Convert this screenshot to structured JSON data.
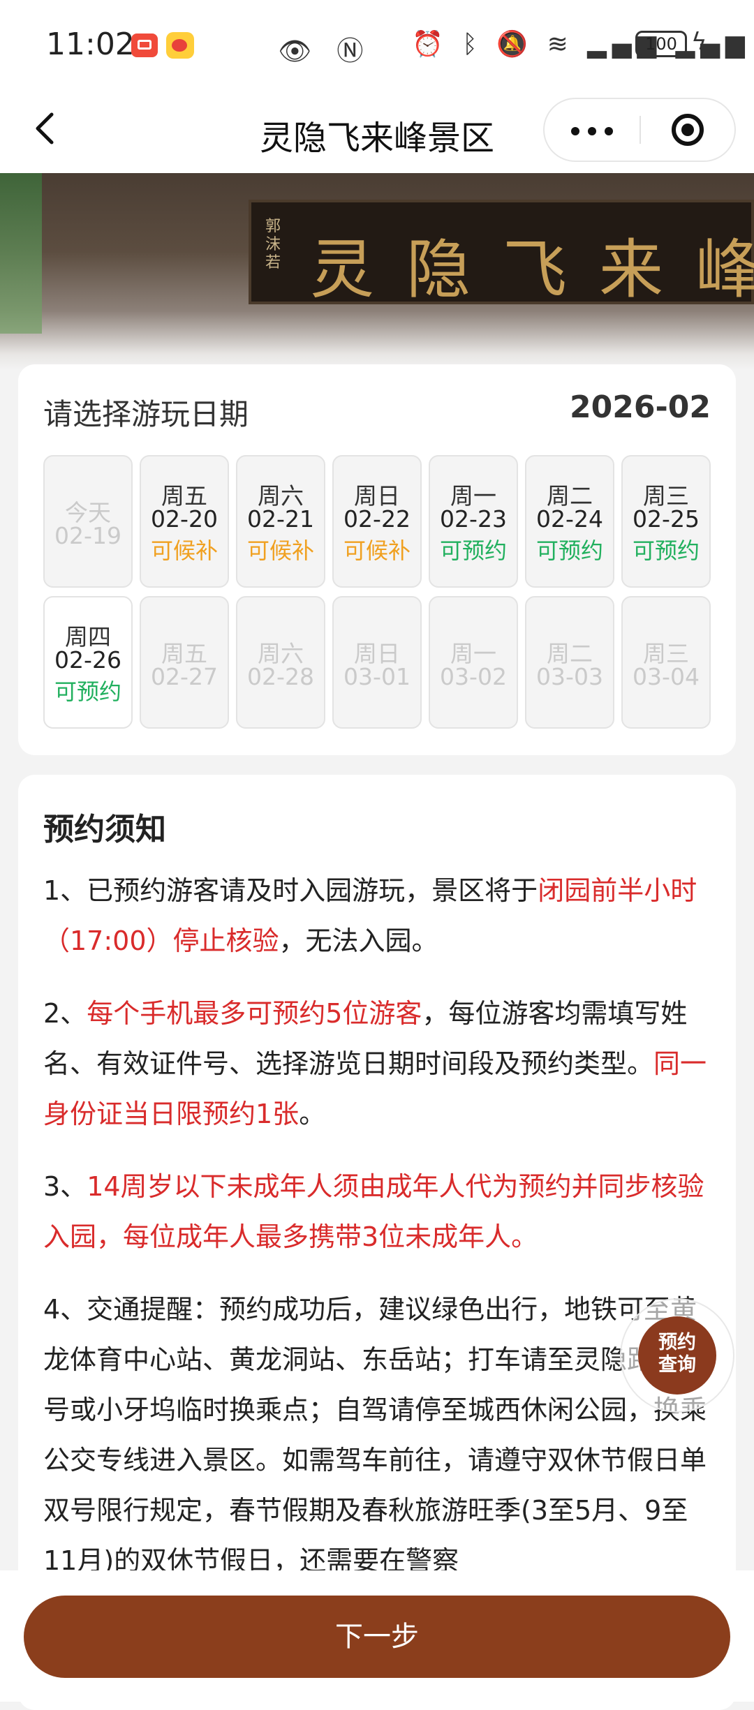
{
  "status_bar": {
    "time": "11:02",
    "battery": "100"
  },
  "nav": {
    "title": "灵隐飞来峰景区"
  },
  "banner": {
    "plaque_text": "灵隐飞来峰",
    "plaque_signature": "郭沫若"
  },
  "date_picker": {
    "title": "请选择游玩日期",
    "month": "2026-02",
    "row1": [
      {
        "weekday": "今天",
        "date": "02-19",
        "status": ""
      },
      {
        "weekday": "周五",
        "date": "02-20",
        "status": "可候补"
      },
      {
        "weekday": "周六",
        "date": "02-21",
        "status": "可候补"
      },
      {
        "weekday": "周日",
        "date": "02-22",
        "status": "可候补"
      },
      {
        "weekday": "周一",
        "date": "02-23",
        "status": "可预约"
      },
      {
        "weekday": "周二",
        "date": "02-24",
        "status": "可预约"
      },
      {
        "weekday": "周三",
        "date": "02-25",
        "status": "可预约"
      }
    ],
    "row2": [
      {
        "weekday": "周四",
        "date": "02-26",
        "status": "可预约"
      },
      {
        "weekday": "周五",
        "date": "02-27",
        "status": ""
      },
      {
        "weekday": "周六",
        "date": "02-28",
        "status": ""
      },
      {
        "weekday": "周日",
        "date": "03-01",
        "status": ""
      },
      {
        "weekday": "周一",
        "date": "03-02",
        "status": ""
      },
      {
        "weekday": "周二",
        "date": "03-03",
        "status": ""
      },
      {
        "weekday": "周三",
        "date": "03-04",
        "status": ""
      }
    ],
    "colors": {
      "waitlist": "#f0a020",
      "available": "#21b05e"
    }
  },
  "notice": {
    "title": "预约须知",
    "item1_a": "1、已预约游客请及时入园游玩，景区将于",
    "item1_red": "闭园前半小时（17:00）停止核验",
    "item1_b": "，无法入园。",
    "item2_a": "2、",
    "item2_red1": "每个手机最多可预约5位游客",
    "item2_b": "，每位游客均需填写姓名、有效证件号、选择游览日期时间段及预约类型。",
    "item2_red2": "同一身份证当日限预约1张",
    "item2_c": "。",
    "item3_a": "3、",
    "item3_red": "14周岁以下未成年人须由成年人代为预约并同步核验入园，每位成年人最多携带3位未成年人。",
    "item4": "4、交通提醒：预约成功后，建议绿色出行，地铁可至黄龙体育中心站、黄龙洞站、东岳站；打车请至灵隐路 608 号或小牙坞临时换乘点；自驾请停至城西休闲公园，换乘公交专线进入景区。如需驾车前往，请遵守双休节假日单双号限行规定，春节假期及春秋旅游旺季(3至5月、9至11月)的双休节假日，还需要在警察",
    "red_color": "#d92b2b"
  },
  "float_button": {
    "line1": "预约",
    "line2": "查询"
  },
  "bottom": {
    "next_label": "下一步"
  }
}
